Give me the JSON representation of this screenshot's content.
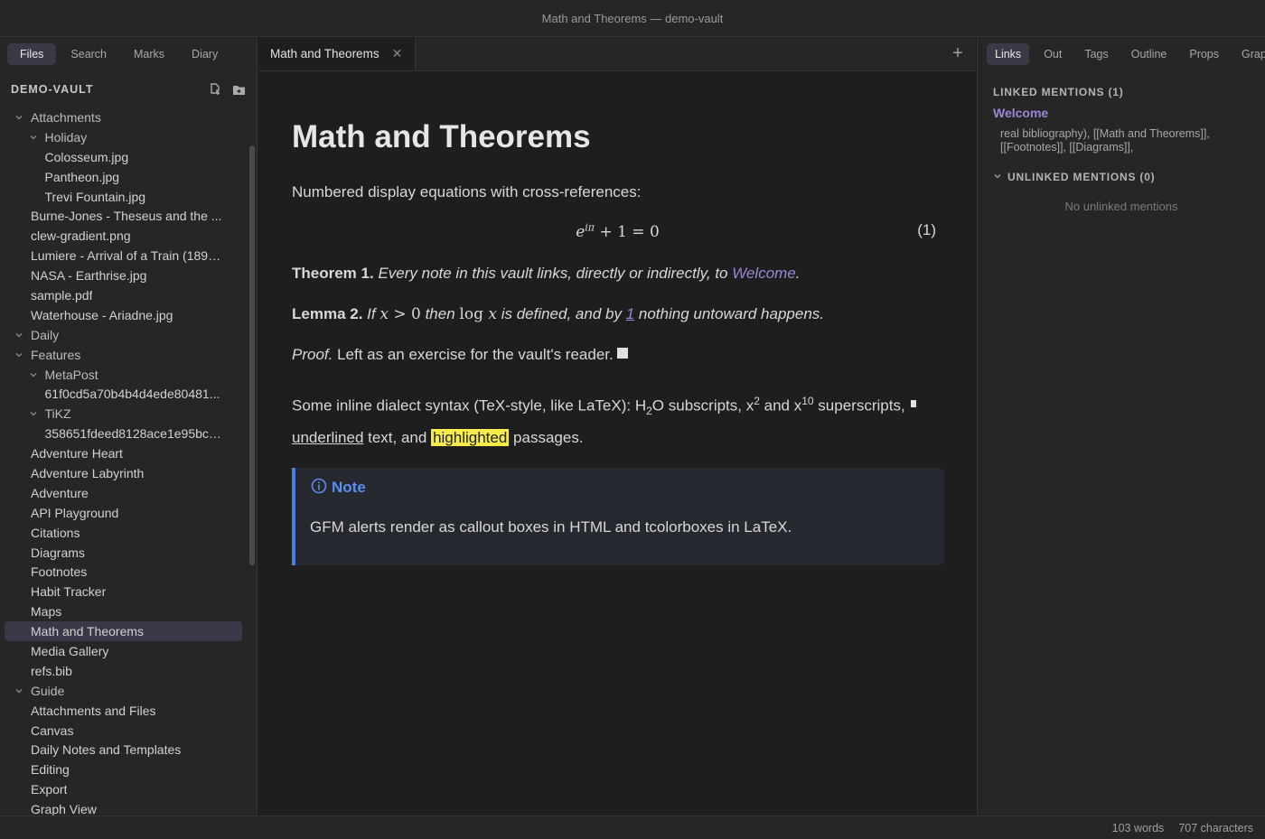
{
  "window": {
    "title": "Math and Theorems — demo-vault"
  },
  "left_sidebar": {
    "tabs": [
      "Files",
      "Search",
      "Marks",
      "Diary"
    ],
    "active_tab": "Files",
    "vault_name": "DEMO-VAULT",
    "tree": [
      {
        "label": "Attachments",
        "folder": true,
        "depth": 0
      },
      {
        "label": "Holiday",
        "folder": true,
        "depth": 1
      },
      {
        "label": "Colosseum.jpg",
        "folder": false,
        "depth": 2
      },
      {
        "label": "Pantheon.jpg",
        "folder": false,
        "depth": 2
      },
      {
        "label": "Trevi Fountain.jpg",
        "folder": false,
        "depth": 2
      },
      {
        "label": "Burne-Jones - Theseus and the ...",
        "folder": false,
        "depth": 1
      },
      {
        "label": "clew-gradient.png",
        "folder": false,
        "depth": 1
      },
      {
        "label": "Lumiere - Arrival of a Train (1895...",
        "folder": false,
        "depth": 1
      },
      {
        "label": "NASA - Earthrise.jpg",
        "folder": false,
        "depth": 1
      },
      {
        "label": "sample.pdf",
        "folder": false,
        "depth": 1
      },
      {
        "label": "Waterhouse - Ariadne.jpg",
        "folder": false,
        "depth": 1
      },
      {
        "label": "Daily",
        "folder": true,
        "depth": 0
      },
      {
        "label": "Features",
        "folder": true,
        "depth": 0
      },
      {
        "label": "MetaPost",
        "folder": true,
        "depth": 1
      },
      {
        "label": "61f0cd5a70b4b4d4ede80481...",
        "folder": false,
        "depth": 2
      },
      {
        "label": "TiKZ",
        "folder": true,
        "depth": 1
      },
      {
        "label": "358651fdeed8128ace1e95bc4...",
        "folder": false,
        "depth": 2
      },
      {
        "label": "Adventure Heart",
        "folder": false,
        "depth": 1
      },
      {
        "label": "Adventure Labyrinth",
        "folder": false,
        "depth": 1
      },
      {
        "label": "Adventure",
        "folder": false,
        "depth": 1
      },
      {
        "label": "API Playground",
        "folder": false,
        "depth": 1
      },
      {
        "label": "Citations",
        "folder": false,
        "depth": 1
      },
      {
        "label": "Diagrams",
        "folder": false,
        "depth": 1
      },
      {
        "label": "Footnotes",
        "folder": false,
        "depth": 1
      },
      {
        "label": "Habit Tracker",
        "folder": false,
        "depth": 1
      },
      {
        "label": "Maps",
        "folder": false,
        "depth": 1
      },
      {
        "label": "Math and Theorems",
        "folder": false,
        "depth": 1,
        "selected": true
      },
      {
        "label": "Media Gallery",
        "folder": false,
        "depth": 1
      },
      {
        "label": "refs.bib",
        "folder": false,
        "depth": 1
      },
      {
        "label": "Guide",
        "folder": true,
        "depth": 0
      },
      {
        "label": "Attachments and Files",
        "folder": false,
        "depth": 1
      },
      {
        "label": "Canvas",
        "folder": false,
        "depth": 1
      },
      {
        "label": "Daily Notes and Templates",
        "folder": false,
        "depth": 1
      },
      {
        "label": "Editing",
        "folder": false,
        "depth": 1
      },
      {
        "label": "Export",
        "folder": false,
        "depth": 1
      },
      {
        "label": "Graph View",
        "folder": false,
        "depth": 1
      }
    ]
  },
  "editor": {
    "tab_label": "Math and Theorems",
    "title": "Math and Theorems",
    "intro": "Numbered display equations with cross-references:",
    "equation_number": "(1)",
    "theorem": {
      "label": "Theorem 1.",
      "text": "Every note in this vault links, directly or indirectly, to",
      "link": "Welcome",
      "end": "."
    },
    "lemma": {
      "label": "Lemma 2.",
      "t1": "If",
      "t2": "then",
      "t3": "is defined, and by",
      "ref": "1",
      "t4": "nothing untoward happens."
    },
    "proof": {
      "label": "Proof.",
      "text": "Left as an exercise for the vault's reader."
    },
    "inline": {
      "a": "Some inline dialect syntax (TeX-style, like LaTeX): H",
      "sub": "2",
      "b": "O subscripts, x",
      "sup1": "2",
      "c": " and x",
      "sup2": "10",
      "d": " superscripts,",
      "underlined": "underlined",
      "e": " text, and ",
      "highlighted": "highlighted",
      "f": " passages."
    },
    "callout": {
      "title": "Note",
      "body": "GFM alerts render as callout boxes in HTML and tcolorboxes in LaTeX."
    }
  },
  "right_sidebar": {
    "tabs": [
      "Links",
      "Out",
      "Tags",
      "Outline",
      "Props",
      "Graph"
    ],
    "active_tab": "Links",
    "linked_header": "LINKED MENTIONS (1)",
    "linked_note": "Welcome",
    "snippet": "real bibliography), [[Math and Theorems]], [[Footnotes]], [[Diagrams]],",
    "unlinked_header": "UNLINKED MENTIONS (0)",
    "unlinked_empty": "No unlinked mentions"
  },
  "status": {
    "words": "103 words",
    "characters": "707 characters"
  },
  "colors": {
    "accent": "#9c86d6",
    "callout": "#4a7fe0",
    "highlight": "#f7ec4a"
  }
}
